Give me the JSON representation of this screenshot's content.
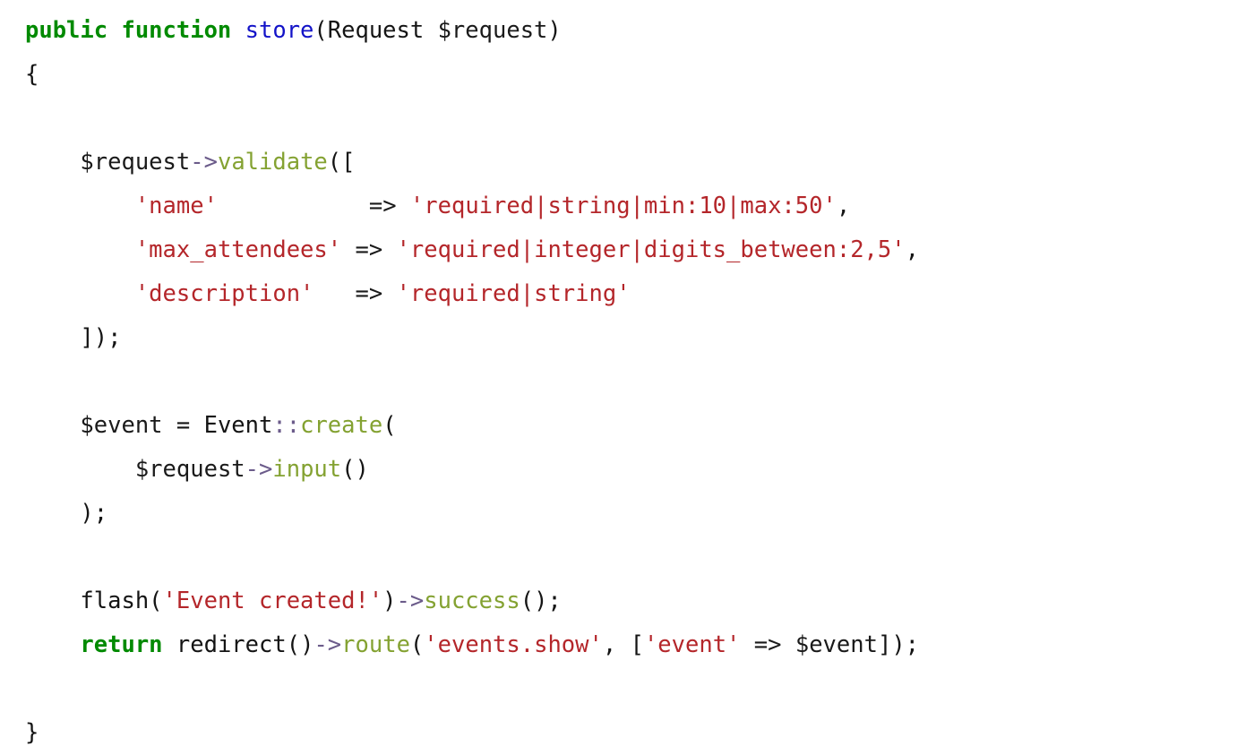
{
  "document": {
    "language": "php",
    "title": "PHP controller store method",
    "background_color": "#ffffff",
    "palette": {
      "keyword": "#008a00",
      "function_name": "#1313c8",
      "variable": "#2b2b9e",
      "method": "#84a232",
      "string": "#b4262a",
      "operator": "#4a4a4a",
      "arrow": "#6b5b8a",
      "plain": "#141414"
    }
  },
  "code": {
    "full_text": "public function store(Request $request)\n{\n\n    $request->validate([\n        'name'           => 'required|string|min:10|max:50',\n        'max_attendees' => 'required|integer|digits_between:2,5',\n        'description'   => 'required|string'\n    ]);\n\n    $event = Event::create(\n        $request->input()\n    );\n\n    flash('Event created!')->success();\n    return redirect()->route('events.show', ['event' => $event]);\n\n}",
    "lines": [
      {
        "number": 1,
        "text": "public function store(Request $request)",
        "tokens": [
          {
            "t": "public function ",
            "c": "keyword"
          },
          {
            "t": "store",
            "c": "funcdef"
          },
          {
            "t": "(Request ",
            "c": "plain"
          },
          {
            "t": "$request",
            "c": "variable"
          },
          {
            "t": ")",
            "c": "plain"
          }
        ]
      },
      {
        "number": 2,
        "text": "{",
        "tokens": [
          {
            "t": "{",
            "c": "plain"
          }
        ]
      },
      {
        "number": 3,
        "text": "",
        "tokens": []
      },
      {
        "number": 4,
        "text": "    $request->validate([",
        "tokens": [
          {
            "t": "    ",
            "c": "plain"
          },
          {
            "t": "$request",
            "c": "variable"
          },
          {
            "t": "->",
            "c": "arrow"
          },
          {
            "t": "validate",
            "c": "method"
          },
          {
            "t": "([",
            "c": "plain"
          }
        ]
      },
      {
        "number": 5,
        "text": "        'name'           => 'required|string|min:10|max:50',",
        "tokens": [
          {
            "t": "        ",
            "c": "plain"
          },
          {
            "t": "'name'",
            "c": "string"
          },
          {
            "t": "           ",
            "c": "plain"
          },
          {
            "t": "=>",
            "c": "operator"
          },
          {
            "t": " ",
            "c": "plain"
          },
          {
            "t": "'required|string|min:10|max:50'",
            "c": "string"
          },
          {
            "t": ",",
            "c": "plain"
          }
        ]
      },
      {
        "number": 6,
        "text": "        'max_attendees' => 'required|integer|digits_between:2,5',",
        "tokens": [
          {
            "t": "        ",
            "c": "plain"
          },
          {
            "t": "'max_attendees'",
            "c": "string"
          },
          {
            "t": " ",
            "c": "plain"
          },
          {
            "t": "=>",
            "c": "operator"
          },
          {
            "t": " ",
            "c": "plain"
          },
          {
            "t": "'required|integer|digits_between:2,5'",
            "c": "string"
          },
          {
            "t": ",",
            "c": "plain"
          }
        ]
      },
      {
        "number": 7,
        "text": "        'description'   => 'required|string'",
        "tokens": [
          {
            "t": "        ",
            "c": "plain"
          },
          {
            "t": "'description'",
            "c": "string"
          },
          {
            "t": "   ",
            "c": "plain"
          },
          {
            "t": "=>",
            "c": "operator"
          },
          {
            "t": " ",
            "c": "plain"
          },
          {
            "t": "'required|string'",
            "c": "string"
          }
        ]
      },
      {
        "number": 8,
        "text": "    ]);",
        "tokens": [
          {
            "t": "    ]);",
            "c": "plain"
          }
        ]
      },
      {
        "number": 9,
        "text": "",
        "tokens": []
      },
      {
        "number": 10,
        "text": "    $event = Event::create(",
        "tokens": [
          {
            "t": "    ",
            "c": "plain"
          },
          {
            "t": "$event",
            "c": "variable"
          },
          {
            "t": " = Event",
            "c": "plain"
          },
          {
            "t": "::",
            "c": "arrow"
          },
          {
            "t": "create",
            "c": "method"
          },
          {
            "t": "(",
            "c": "plain"
          }
        ]
      },
      {
        "number": 11,
        "text": "        $request->input()",
        "tokens": [
          {
            "t": "        ",
            "c": "plain"
          },
          {
            "t": "$request",
            "c": "variable"
          },
          {
            "t": "->",
            "c": "arrow"
          },
          {
            "t": "input",
            "c": "method"
          },
          {
            "t": "()",
            "c": "plain"
          }
        ]
      },
      {
        "number": 12,
        "text": "    );",
        "tokens": [
          {
            "t": "    );",
            "c": "plain"
          }
        ]
      },
      {
        "number": 13,
        "text": "",
        "tokens": []
      },
      {
        "number": 14,
        "text": "    flash('Event created!')->success();",
        "tokens": [
          {
            "t": "    flash(",
            "c": "plain"
          },
          {
            "t": "'Event created!'",
            "c": "string"
          },
          {
            "t": ")",
            "c": "plain"
          },
          {
            "t": "->",
            "c": "arrow"
          },
          {
            "t": "success",
            "c": "method"
          },
          {
            "t": "();",
            "c": "plain"
          }
        ]
      },
      {
        "number": 15,
        "text": "    return redirect()->route('events.show', ['event' => $event]);",
        "tokens": [
          {
            "t": "    ",
            "c": "plain"
          },
          {
            "t": "return",
            "c": "keyword"
          },
          {
            "t": " redirect()",
            "c": "plain"
          },
          {
            "t": "->",
            "c": "arrow"
          },
          {
            "t": "route",
            "c": "method"
          },
          {
            "t": "(",
            "c": "plain"
          },
          {
            "t": "'events.show'",
            "c": "string"
          },
          {
            "t": ", [",
            "c": "plain"
          },
          {
            "t": "'event'",
            "c": "string"
          },
          {
            "t": " ",
            "c": "plain"
          },
          {
            "t": "=>",
            "c": "operator"
          },
          {
            "t": " ",
            "c": "plain"
          },
          {
            "t": "$event",
            "c": "variable"
          },
          {
            "t": "]);",
            "c": "plain"
          }
        ]
      },
      {
        "number": 16,
        "text": "",
        "tokens": []
      },
      {
        "number": 17,
        "text": "}",
        "tokens": [
          {
            "t": "}",
            "c": "plain"
          }
        ]
      }
    ]
  }
}
